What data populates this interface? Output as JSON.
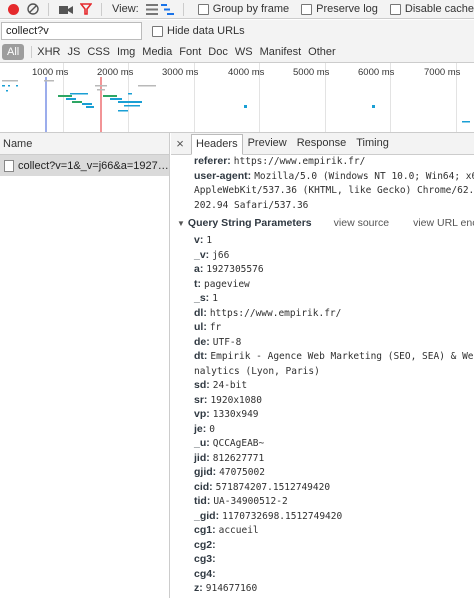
{
  "toolbar": {
    "view_label": "View:",
    "group_by_frame": "Group by frame",
    "preserve_log": "Preserve log",
    "disable_cache": "Disable cache"
  },
  "filter": {
    "value": "collect?v",
    "hide_data_urls": "Hide data URLs"
  },
  "type_filters": [
    "All",
    "XHR",
    "JS",
    "CSS",
    "Img",
    "Media",
    "Font",
    "Doc",
    "WS",
    "Manifest",
    "Other"
  ],
  "overview": {
    "labels": [
      "1000 ms",
      "2000 ms",
      "3000 ms",
      "4000 ms",
      "5000 ms",
      "6000 ms",
      "7000 ms"
    ]
  },
  "request_list": {
    "header": "Name",
    "selected": "collect?v=1&_v=j66&a=19273..."
  },
  "detail": {
    "tabs": [
      "Headers",
      "Preview",
      "Response",
      "Timing"
    ],
    "headers_tail": {
      "referer_key": "referer:",
      "referer_val": "https://www.empirik.fr/",
      "ua_key": "user-agent:",
      "ua_val": "Mozilla/5.0 (Windows NT 10.0; Win64; x6",
      "ua_cont1": "AppleWebKit/537.36 (KHTML, like Gecko) Chrome/62.0",
      "ua_cont2": "202.94 Safari/537.36"
    },
    "qs_title": "Query String Parameters",
    "view_source": "view source",
    "view_url_encoded": "view URL enco",
    "params": [
      {
        "k": "v:",
        "v": "1"
      },
      {
        "k": "_v:",
        "v": "j66"
      },
      {
        "k": "a:",
        "v": "1927305576"
      },
      {
        "k": "t:",
        "v": "pageview"
      },
      {
        "k": "_s:",
        "v": "1"
      },
      {
        "k": "dl:",
        "v": "https://www.empirik.fr/"
      },
      {
        "k": "ul:",
        "v": "fr"
      },
      {
        "k": "de:",
        "v": "UTF-8"
      },
      {
        "k": "dt:",
        "v": "Empirik - Agence Web Marketing (SEO, SEA) & We",
        "cont": "nalytics (Lyon, Paris)"
      },
      {
        "k": "sd:",
        "v": "24-bit"
      },
      {
        "k": "sr:",
        "v": "1920x1080"
      },
      {
        "k": "vp:",
        "v": "1330x949"
      },
      {
        "k": "je:",
        "v": "0"
      },
      {
        "k": "_u:",
        "v": "QCCAgEAB~"
      },
      {
        "k": "jid:",
        "v": "812627771"
      },
      {
        "k": "gjid:",
        "v": "47075002"
      },
      {
        "k": "cid:",
        "v": "571874207.1512749420"
      },
      {
        "k": "tid:",
        "v": "UA-34900512-2"
      },
      {
        "k": "_gid:",
        "v": "1170732698.1512749420"
      },
      {
        "k": "cg1:",
        "v": "accueil"
      },
      {
        "k": "cg2:",
        "v": ""
      },
      {
        "k": "cg3:",
        "v": ""
      },
      {
        "k": "cg4:",
        "v": ""
      },
      {
        "k": "z:",
        "v": "914677160"
      }
    ]
  },
  "colors": {
    "record": "#e5292c",
    "filter_active": "#e5292c",
    "selected_row": "#dadada",
    "bar_green": "#2ea664",
    "bar_blue": "#1a9fd4"
  },
  "icons": [
    "record-icon",
    "clear-icon",
    "camera-icon",
    "filter-icon",
    "large-rows-icon",
    "waterfall-icon",
    "close-icon",
    "file-icon"
  ]
}
